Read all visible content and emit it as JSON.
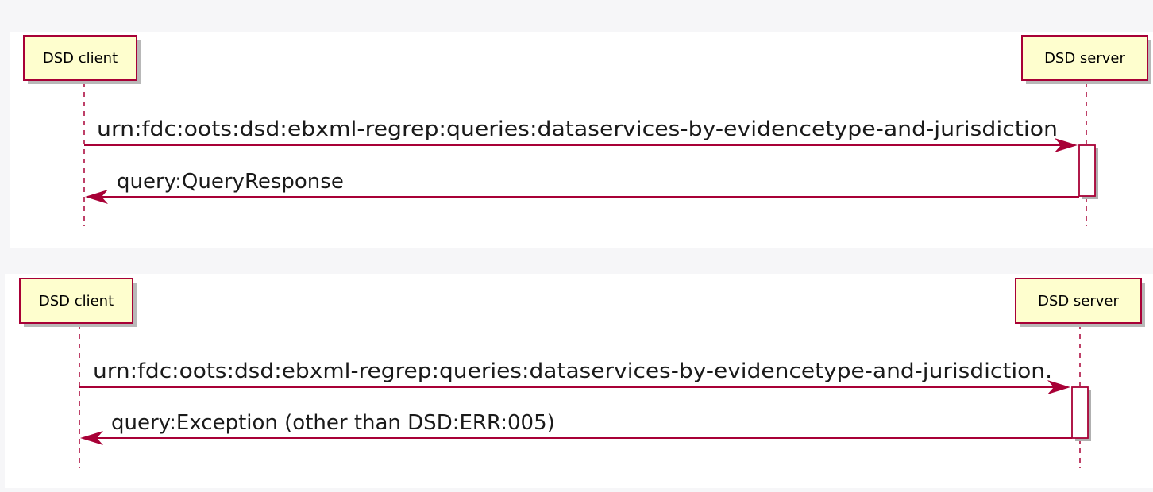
{
  "diagrams": [
    {
      "client_label": "DSD client",
      "server_label": "DSD server",
      "request_label": "urn:fdc:oots:dsd:ebxml-regrep:queries:dataservices-by-evidencetype-and-jurisdiction",
      "response_label": "query:QueryResponse"
    },
    {
      "client_label": "DSD client",
      "server_label": "DSD server",
      "request_label": "urn:fdc:oots:dsd:ebxml-regrep:queries:dataservices-by-evidencetype-and-jurisdiction.",
      "response_label": "query:Exception (other than DSD:ERR:005)"
    }
  ],
  "colors": {
    "accent": "#a80036",
    "participant_fill": "#fefece",
    "background": "#f6f6f8",
    "panel": "#ffffff"
  }
}
